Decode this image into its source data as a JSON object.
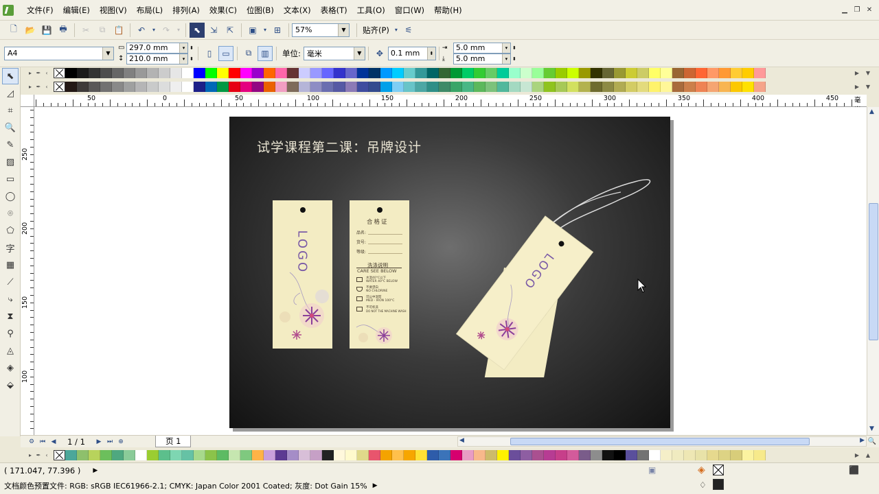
{
  "menu": [
    "文件(F)",
    "编辑(E)",
    "视图(V)",
    "布局(L)",
    "排列(A)",
    "效果(C)",
    "位图(B)",
    "文本(X)",
    "表格(T)",
    "工具(O)",
    "窗口(W)",
    "帮助(H)"
  ],
  "toolbar": {
    "zoom": "57%",
    "snap": "贴齐(P)"
  },
  "props": {
    "paper": "A4",
    "width": "297.0 mm",
    "height": "210.0 mm",
    "unit_label": "单位:",
    "unit": "毫米",
    "nudge": "0.1 mm",
    "dup_x": "5.0 mm",
    "dup_y": "5.0 mm"
  },
  "ruler": {
    "h_labels": [
      "50",
      "0",
      "50",
      "100",
      "150",
      "200",
      "250",
      "300",
      "350",
      "400",
      "450"
    ],
    "h_unit": "毫米",
    "v_labels": [
      "250",
      "200",
      "150",
      "100"
    ]
  },
  "page": {
    "title": "试学课程第二课：吊牌设计",
    "logo": "LOGO",
    "cert_title": "合格证",
    "cert_fields": [
      "品名:",
      "货号:",
      "等级:"
    ],
    "care_title": "洗涤说明",
    "care_sub": "CARE SEE BELOW",
    "care_items": [
      {
        "cn": "水温40°C以下",
        "en": "WATER 40°C BELOW"
      },
      {
        "cn": "不要漂白",
        "en": "NO CHLORINE"
      },
      {
        "cn": "可以中温熨",
        "en": "MED - IRON 100°C"
      },
      {
        "cn": "不可机洗",
        "en": "DO NOT THE MACHINE WASH"
      }
    ]
  },
  "pager": {
    "count": "1 / 1",
    "tab": "页 1"
  },
  "status": {
    "coords": "( 171.047, 77.396 )",
    "profile": "文档颜色预置文件: RGB: sRGB IEC61966-2.1; CMYK: Japan Color 2001 Coated; 灰度: Dot Gain 15%"
  },
  "palette_top": [
    "#000000",
    "#1a1a1a",
    "#333333",
    "#4d4d4d",
    "#666666",
    "#808080",
    "#999999",
    "#b3b3b3",
    "#cccccc",
    "#e6e6e6",
    "#ffffff",
    "#0000ff",
    "#00ff00",
    "#ffff00",
    "#ff0000",
    "#ff00ff",
    "#9900cc",
    "#ff6600",
    "#ff66aa",
    "#663333",
    "#ccccff",
    "#9999ff",
    "#6666ff",
    "#3333cc",
    "#6666cc",
    "#003399",
    "#003366",
    "#0099ff",
    "#00ccff",
    "#66cccc",
    "#339999",
    "#006666",
    "#336633",
    "#009933",
    "#00cc66",
    "#33cc33",
    "#66cc66",
    "#00cc99",
    "#99ffcc",
    "#ccffcc",
    "#99ff99",
    "#66cc33",
    "#99cc00",
    "#ccff00",
    "#999900",
    "#333300",
    "#666633",
    "#999933",
    "#cccc33",
    "#cccc66",
    "#ffff66",
    "#ffff99",
    "#996633",
    "#cc6633",
    "#ff6633",
    "#ff9966",
    "#ff9933",
    "#ffcc33",
    "#ffcc00",
    "#ff9999"
  ],
  "palette_mid": [
    "#231815",
    "#3e3a39",
    "#595757",
    "#727171",
    "#898989",
    "#9fa0a0",
    "#b5b5b6",
    "#c9caca",
    "#dcdddd",
    "#efefef",
    "#ffffff",
    "#1d2088",
    "#0068b7",
    "#009944",
    "#e60012",
    "#e4007f",
    "#920783",
    "#eb6100",
    "#f19ec2",
    "#7e6b5a",
    "#b5b5d8",
    "#8e8dc4",
    "#6a6eb0",
    "#5659a4",
    "#8c7ab6",
    "#3f4c9f",
    "#334b8e",
    "#00a0e9",
    "#7ecef4",
    "#68c4c8",
    "#4ca7a4",
    "#2e8f87",
    "#3e8a67",
    "#39a567",
    "#49b785",
    "#5cb85c",
    "#7cc27b",
    "#51b89c",
    "#a3d9c1",
    "#c7e6d3",
    "#aad47e",
    "#8fc31f",
    "#a7c957",
    "#d2e05f",
    "#b3b24f",
    "#6e6b2e",
    "#8d8a45",
    "#b1ab53",
    "#d3cc64",
    "#e3db7d",
    "#fff36b",
    "#fff799",
    "#a86b3c",
    "#cc7f4a",
    "#ee8354",
    "#f5a572",
    "#f8b551",
    "#fcc800",
    "#ffe100",
    "#f5a48a"
  ],
  "palette_bottom": [
    "#4ca79a",
    "#8ec06c",
    "#b8d35c",
    "#6cbf5c",
    "#4fa880",
    "#8acb99",
    "#ffffff",
    "#9acd32",
    "#5cbf8c",
    "#7ed6b2",
    "#66c2a5",
    "#a7d98c",
    "#8bc34a",
    "#5dbb63",
    "#c6e6b0",
    "#7fc97f",
    "#ffb347",
    "#c9a0dc",
    "#5c3a92",
    "#a58dc7",
    "#d8bfd8",
    "#c6a0c6",
    "#222222",
    "#fff8dc",
    "#fffacd",
    "#e0d98a",
    "#e8556d",
    "#f4a300",
    "#ffc04c",
    "#f7a600",
    "#ffe135",
    "#2e5caa",
    "#3b73b9",
    "#d6006f",
    "#e89cc4",
    "#f8b88b",
    "#cdbb6a",
    "#fff200",
    "#6b4e9b",
    "#8e5ea2",
    "#aa5090",
    "#b73c93",
    "#c73f8a",
    "#d35b9b",
    "#7a5c8a",
    "#8d8d8d",
    "#111111",
    "#000000",
    "#5a4f9c",
    "#737373",
    "#ffffff",
    "#f5efc8",
    "#f0ebc0",
    "#eee7b4",
    "#e8e2a8",
    "#e6d98e",
    "#ddd384",
    "#d8cd7a",
    "#fbf3a0",
    "#f7ea8b"
  ]
}
